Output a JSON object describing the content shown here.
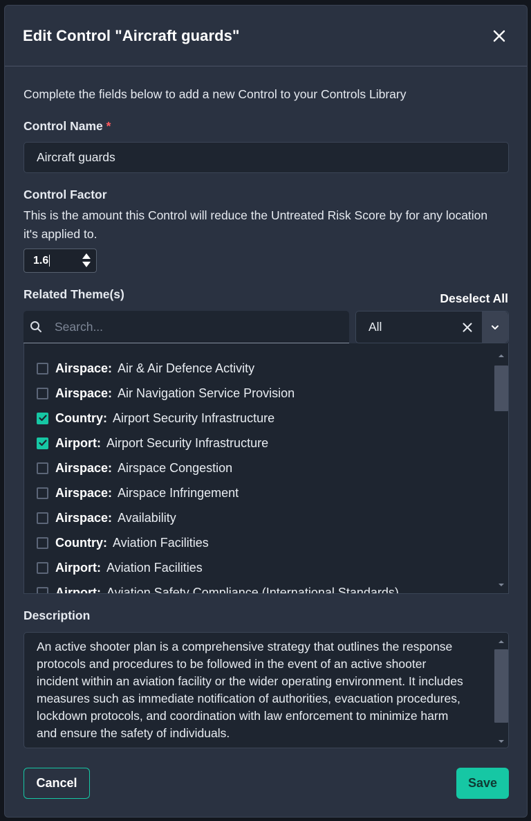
{
  "modal": {
    "title": "Edit Control \"Aircraft guards\""
  },
  "form": {
    "intro": "Complete the fields below to add a new Control to your Controls Library",
    "control_name": {
      "label": "Control Name",
      "required_mark": "*",
      "value": "Aircraft guards"
    },
    "control_factor": {
      "label": "Control Factor",
      "description": "This is the amount this Control will reduce the Untreated Risk Score by for any location it's applied to.",
      "value": "1.6"
    },
    "themes": {
      "label": "Related Theme(s)",
      "deselect_all": "Deselect All",
      "search_placeholder": "Search...",
      "filter_value": "All",
      "items": [
        {
          "prefix": "Airspace:",
          "text": "Air & Air Defence Activity",
          "checked": false
        },
        {
          "prefix": "Airspace:",
          "text": "Air Navigation Service Provision",
          "checked": false
        },
        {
          "prefix": "Country:",
          "text": "Airport Security Infrastructure",
          "checked": true
        },
        {
          "prefix": "Airport:",
          "text": "Airport Security Infrastructure",
          "checked": true
        },
        {
          "prefix": "Airspace:",
          "text": "Airspace Congestion",
          "checked": false
        },
        {
          "prefix": "Airspace:",
          "text": "Airspace Infringement",
          "checked": false
        },
        {
          "prefix": "Airspace:",
          "text": "Availability",
          "checked": false
        },
        {
          "prefix": "Country:",
          "text": "Aviation Facilities",
          "checked": false
        },
        {
          "prefix": "Airport:",
          "text": "Aviation Facilities",
          "checked": false
        },
        {
          "prefix": "Airport:",
          "text": "Aviation Safety Compliance (International Standards)",
          "checked": false
        }
      ]
    },
    "description": {
      "label": "Description",
      "value": "An active shooter plan is a comprehensive strategy that outlines the response protocols and procedures to be followed in the event of an active shooter incident within an aviation facility or the wider operating environment. It includes measures such as immediate notification of authorities, evacuation procedures, lockdown protocols, and coordination with law enforcement to minimize harm and ensure the safety of individuals."
    }
  },
  "footer": {
    "cancel_label": "Cancel",
    "save_label": "Save"
  },
  "colors": {
    "accent": "#16c7a4",
    "background": "#2a3241",
    "input_bg": "#1e2530",
    "required": "#ff5a5f"
  }
}
